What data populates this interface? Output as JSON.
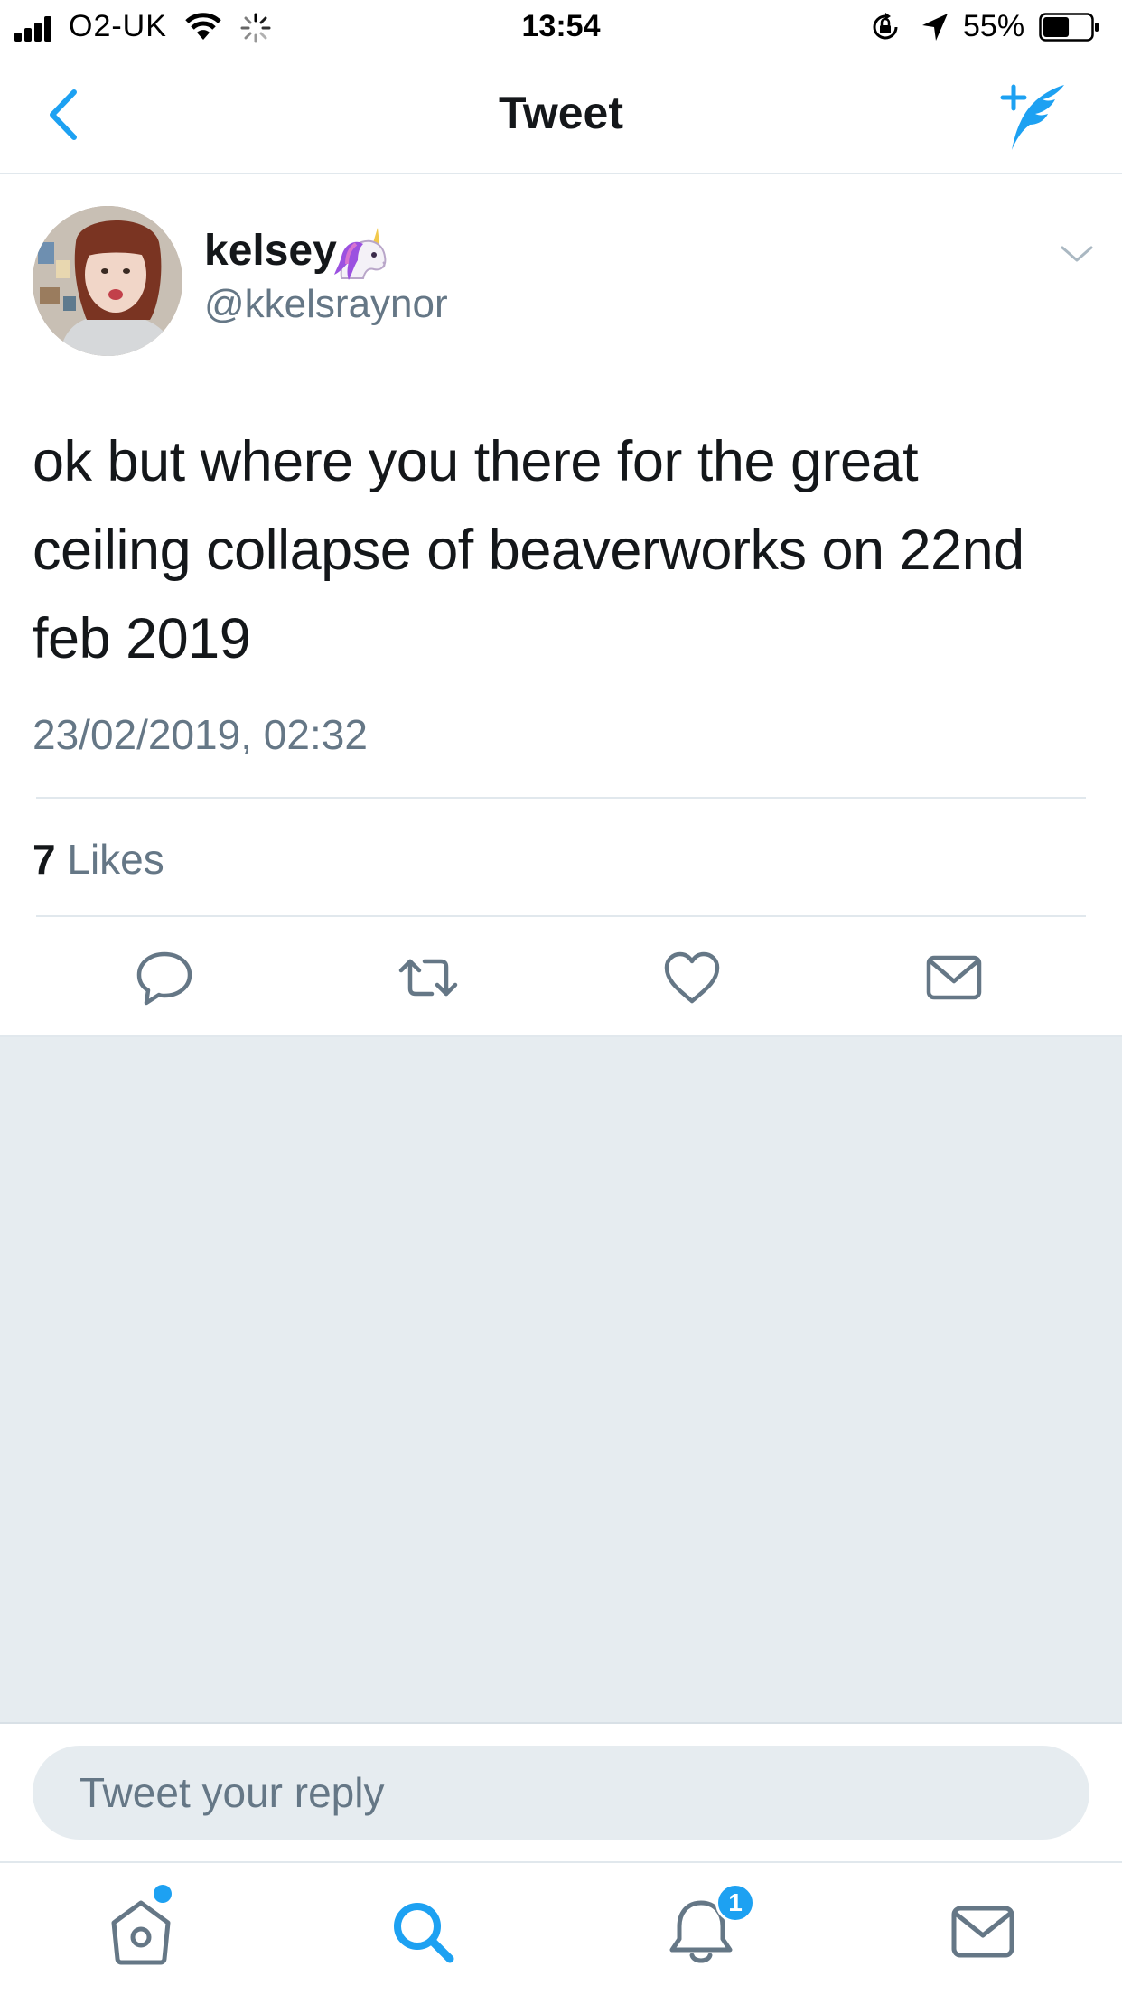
{
  "status_bar": {
    "carrier": "O2-UK",
    "time": "13:54",
    "battery_percent": "55%",
    "battery_level": 0.55,
    "icons": [
      "signal-icon",
      "wifi-icon",
      "activity-spinner-icon",
      "rotation-lock-icon",
      "location-arrow-icon",
      "battery-icon"
    ]
  },
  "nav": {
    "title": "Tweet",
    "back_icon": "chevron-left-icon",
    "compose_icon": "compose-tweet-icon"
  },
  "tweet": {
    "display_name": "kelsey",
    "name_emoji": "unicorn-icon",
    "handle": "@kkelsraynor",
    "text": "ok but where you there for the great ceiling collapse of beaverworks on 22nd feb 2019",
    "timestamp": "23/02/2019, 02:32",
    "likes_count": "7",
    "likes_label": "Likes",
    "actions": [
      "reply-icon",
      "retweet-icon",
      "like-icon",
      "direct-message-icon"
    ]
  },
  "reply": {
    "placeholder": "Tweet your reply"
  },
  "tab_bar": {
    "tabs": [
      "home-icon",
      "search-icon",
      "notifications-icon",
      "messages-icon"
    ],
    "notifications_badge": "1"
  },
  "colors": {
    "accent": "#1da1f2",
    "secondary_text": "#657786",
    "primary_text": "#14171a",
    "background_grey": "#e6ecf0"
  }
}
